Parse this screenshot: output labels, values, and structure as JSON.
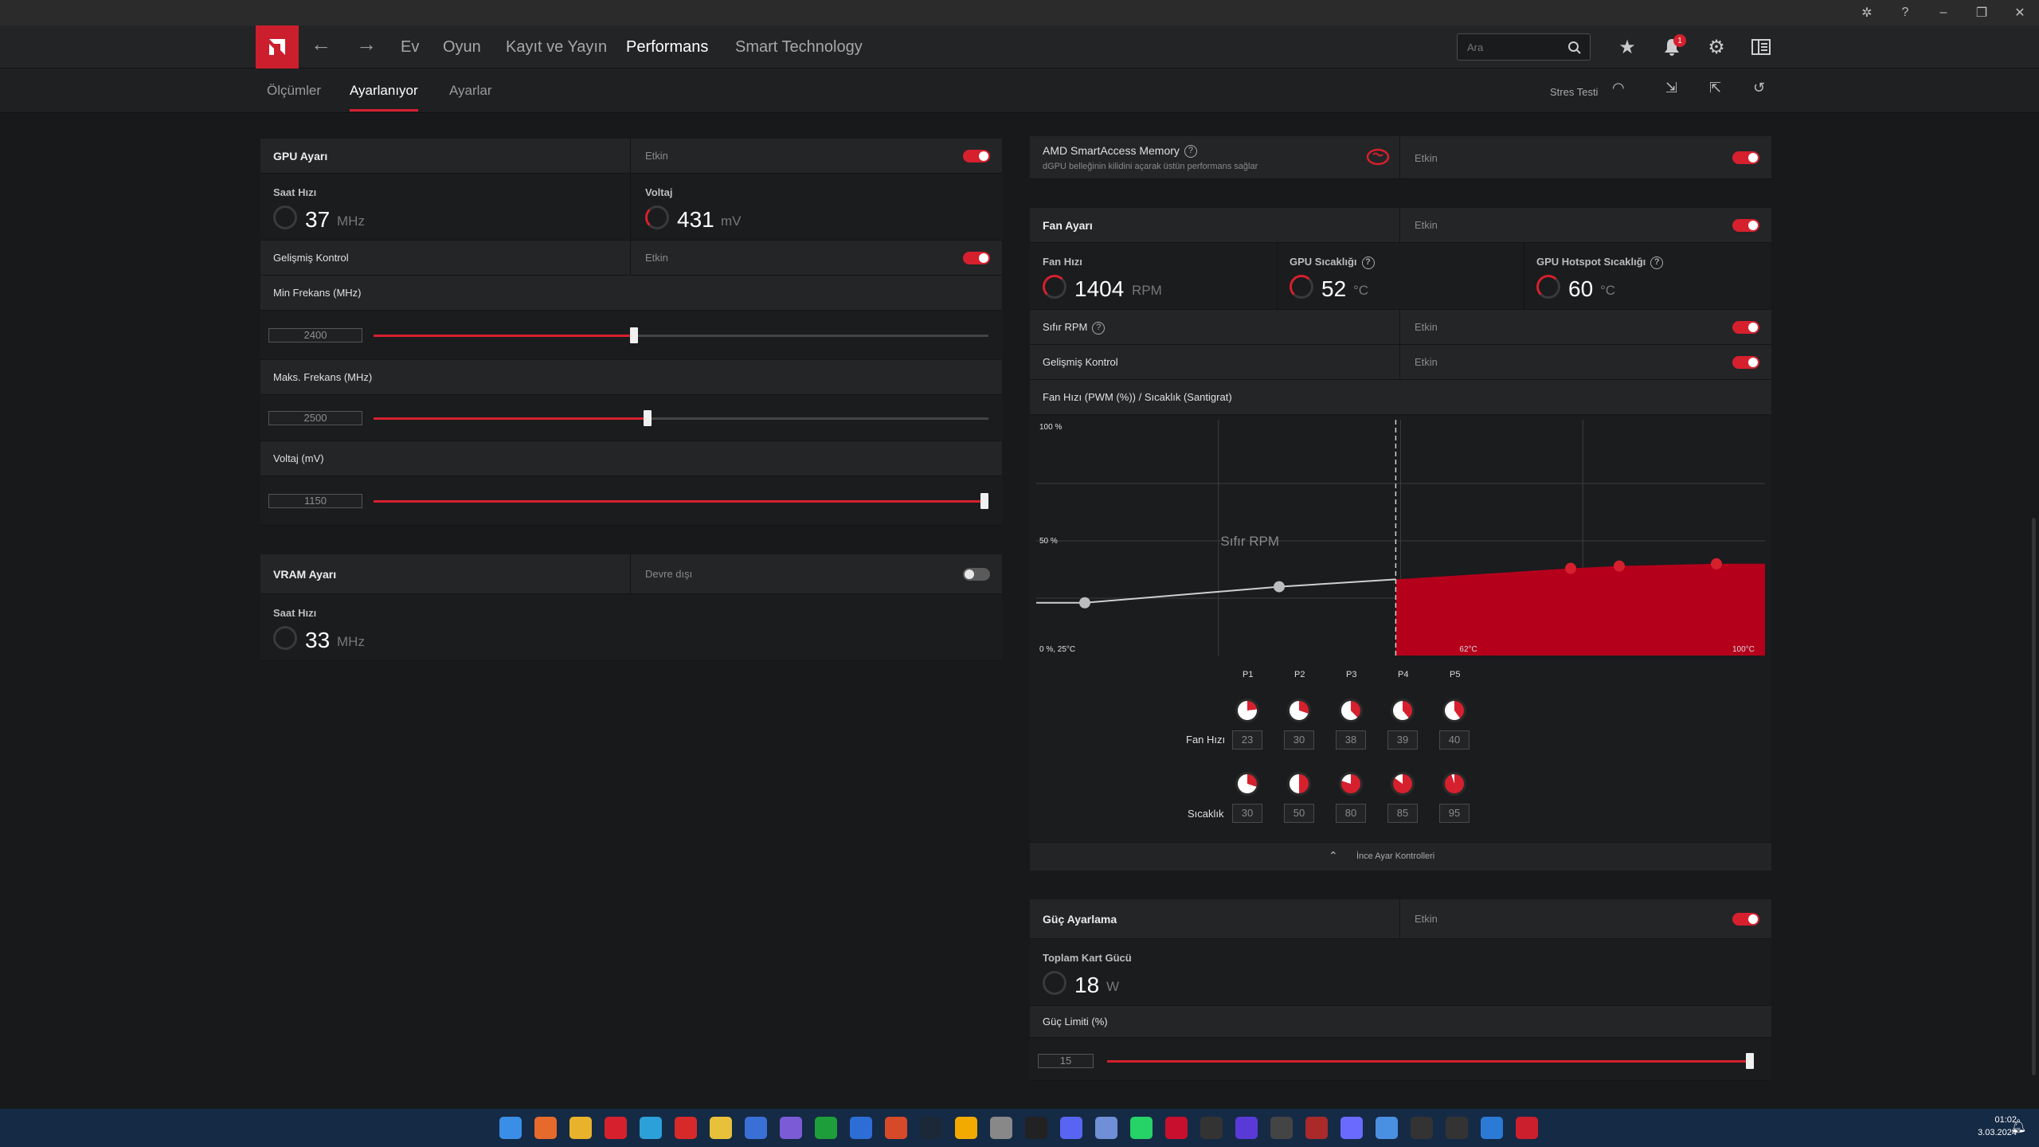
{
  "window": {
    "bug_icon": "bug-icon",
    "help_icon": "help-icon",
    "minimize": "–",
    "restore": "❐",
    "close": "✕"
  },
  "nav": {
    "items": [
      "Ev",
      "Oyun",
      "Kayıt ve Yayın",
      "Performans",
      "Smart Technology"
    ],
    "active": "Performans",
    "search_placeholder": "Ara",
    "notification_count": "1"
  },
  "subnav": {
    "items": [
      "Ölçümler",
      "Ayarlanıyor",
      "Ayarlar"
    ],
    "active": "Ayarlanıyor",
    "stress_test": "Stres Testi"
  },
  "gpu": {
    "title": "GPU Ayarı",
    "state": "Etkin",
    "clock_label": "Saat Hızı",
    "clock_value": "37",
    "clock_unit": "MHz",
    "voltage_label": "Voltaj",
    "voltage_value": "431",
    "voltage_unit": "mV",
    "advanced_label": "Gelişmiş Kontrol",
    "advanced_state": "Etkin",
    "min_freq_label": "Min Frekans (MHz)",
    "min_freq_value": "2400",
    "min_freq_pct": 0.423,
    "max_freq_label": "Maks. Frekans (MHz)",
    "max_freq_value": "2500",
    "max_freq_pct": 0.445,
    "voltage_mv_label": "Voltaj (mV)",
    "voltage_mv_value": "1150",
    "voltage_mv_pct": 0.993
  },
  "vram": {
    "title": "VRAM Ayarı",
    "state": "Devre dışı",
    "clock_label": "Saat Hızı",
    "clock_value": "33",
    "clock_unit": "MHz"
  },
  "sam": {
    "title": "AMD SmartAccess Memory",
    "subtitle": "dGPU belleğinin kilidini açarak üstün performans sağlar",
    "state": "Etkin"
  },
  "fan": {
    "title": "Fan Ayarı",
    "state": "Etkin",
    "speed_label": "Fan Hızı",
    "speed_value": "1404",
    "speed_unit": "RPM",
    "gpu_temp_label": "GPU Sıcaklığı",
    "gpu_temp_value": "52",
    "gpu_temp_unit": "°C",
    "hotspot_label": "GPU Hotspot Sıcaklığı",
    "hotspot_value": "60",
    "hotspot_unit": "°C",
    "zero_rpm_label": "Sıfır RPM",
    "zero_rpm_state": "Etkin",
    "advanced_label": "Gelişmiş Kontrol",
    "advanced_state": "Etkin",
    "curve_label": "Fan Hızı (PWM (%)) / Sıcaklık (Santigrat)",
    "fan_row_label": "Fan Hızı",
    "temp_row_label": "Sıcaklık",
    "fine_tune": "İnce Ayar Kontrolleri"
  },
  "chart_data": {
    "type": "area",
    "y_top_label": "100 %",
    "y_mid_label": "50 %",
    "origin_label": "0 %, 25°C",
    "zero_rpm_text": "Sıfır RPM",
    "threshold_label": "62°C",
    "x_max_label": "100°C",
    "points": [
      "P1",
      "P2",
      "P3",
      "P4",
      "P5"
    ],
    "fan_speeds": [
      "23",
      "30",
      "38",
      "39",
      "40"
    ],
    "temperatures": [
      "30",
      "50",
      "80",
      "85",
      "95"
    ],
    "xlim": [
      25,
      100
    ],
    "ylim": [
      0,
      100
    ],
    "zero_rpm_until": 62,
    "curve": [
      [
        30,
        23
      ],
      [
        50,
        30
      ],
      [
        80,
        38
      ],
      [
        85,
        39
      ],
      [
        95,
        40
      ]
    ]
  },
  "power": {
    "title": "Güç Ayarlama",
    "state": "Etkin",
    "total_label": "Toplam Kart Gücü",
    "total_value": "18",
    "total_unit": "W",
    "limit_label": "Güç Limiti (%)",
    "limit_value": "15",
    "limit_pct": 1.0
  },
  "tray": {
    "time": "01:02",
    "date": "3.03.2024"
  }
}
